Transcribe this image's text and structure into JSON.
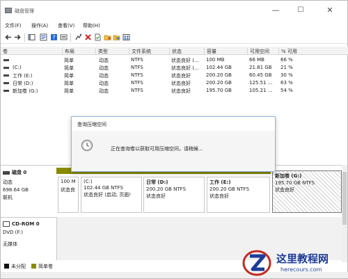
{
  "window": {
    "title": "磁盘管理",
    "controls": {
      "minimize": "—",
      "maximize": "☐",
      "close": "✕"
    }
  },
  "menu": [
    "文件(F)",
    "操作(A)",
    "查看(V)",
    "帮助(H)"
  ],
  "toolbar_icons": [
    "back-arrow-icon",
    "forward-arrow-icon",
    "console-tree-icon",
    "properties-icon",
    "help-icon",
    "disk-list-icon",
    "connect-icon",
    "delete-icon",
    "document-icon",
    "folder-icon",
    "export-icon",
    "refresh-icon"
  ],
  "volume_list": {
    "columns": [
      "卷",
      "布局",
      "类型",
      "文件系统",
      "状态",
      "容量",
      "可用空间",
      "% 可用"
    ],
    "rows": [
      {
        "volume": "",
        "layout": "简单",
        "type": "动态",
        "fs": "NTFS",
        "status": "状态良好 (...",
        "capacity": "100 MB",
        "free": "66 MB",
        "pct": "66 %"
      },
      {
        "volume": "(C:)",
        "layout": "简单",
        "type": "动态",
        "fs": "NTFS",
        "status": "状态良好 (...",
        "capacity": "102.44 GB",
        "free": "21.81 GB",
        "pct": "21 %"
      },
      {
        "volume": "工作 (E:)",
        "layout": "简单",
        "type": "动态",
        "fs": "NTFS",
        "status": "状态良好",
        "capacity": "200.20 GB",
        "free": "60.45 GB",
        "pct": "30 %"
      },
      {
        "volume": "日常 (D:)",
        "layout": "简单",
        "type": "动态",
        "fs": "NTFS",
        "status": "状态良好",
        "capacity": "200.20 GB",
        "free": "125.51 ...",
        "pct": "63 %"
      },
      {
        "volume": "新加卷 (G:)",
        "layout": "简单",
        "type": "动态",
        "fs": "NTFS",
        "status": "状态良好",
        "capacity": "195.70 GB",
        "free": "105.21 ...",
        "pct": "54 %"
      }
    ]
  },
  "disk0": {
    "name": "磁盘 0",
    "type": "动态",
    "size": "698.64 GB",
    "status": "联机",
    "partitions": [
      {
        "line1": "100 M",
        "line2": "状态良"
      },
      {
        "line1": "(C:)",
        "line2": "102.44 GB NTFS",
        "line3": "状态良好 (启动, 页面!"
      },
      {
        "line1": "日常  (D:)",
        "line2": "200.20 GB NTFS",
        "line3": "状态良好"
      },
      {
        "line1": "工作  (E:)",
        "line2": "200.20 GB NTFS",
        "line3": "状态良好"
      },
      {
        "line1": "新加卷  (G:)",
        "line2": "195.70 GB NTFS",
        "line3": "状态良好"
      }
    ]
  },
  "cdrom": {
    "name": "CD-ROM 0",
    "drive": "DVD (F:)",
    "status": "无媒体"
  },
  "legend": [
    {
      "label": "未分配",
      "color": "#111111"
    },
    {
      "label": "简单卷",
      "color": "#8a8a00"
    }
  ],
  "dialog": {
    "title": "查询压缩空间",
    "message": "正在查询卷以获取可用压缩空间，请稍候..."
  },
  "watermark": {
    "title": "这里教程网",
    "url": "herecours.com"
  }
}
